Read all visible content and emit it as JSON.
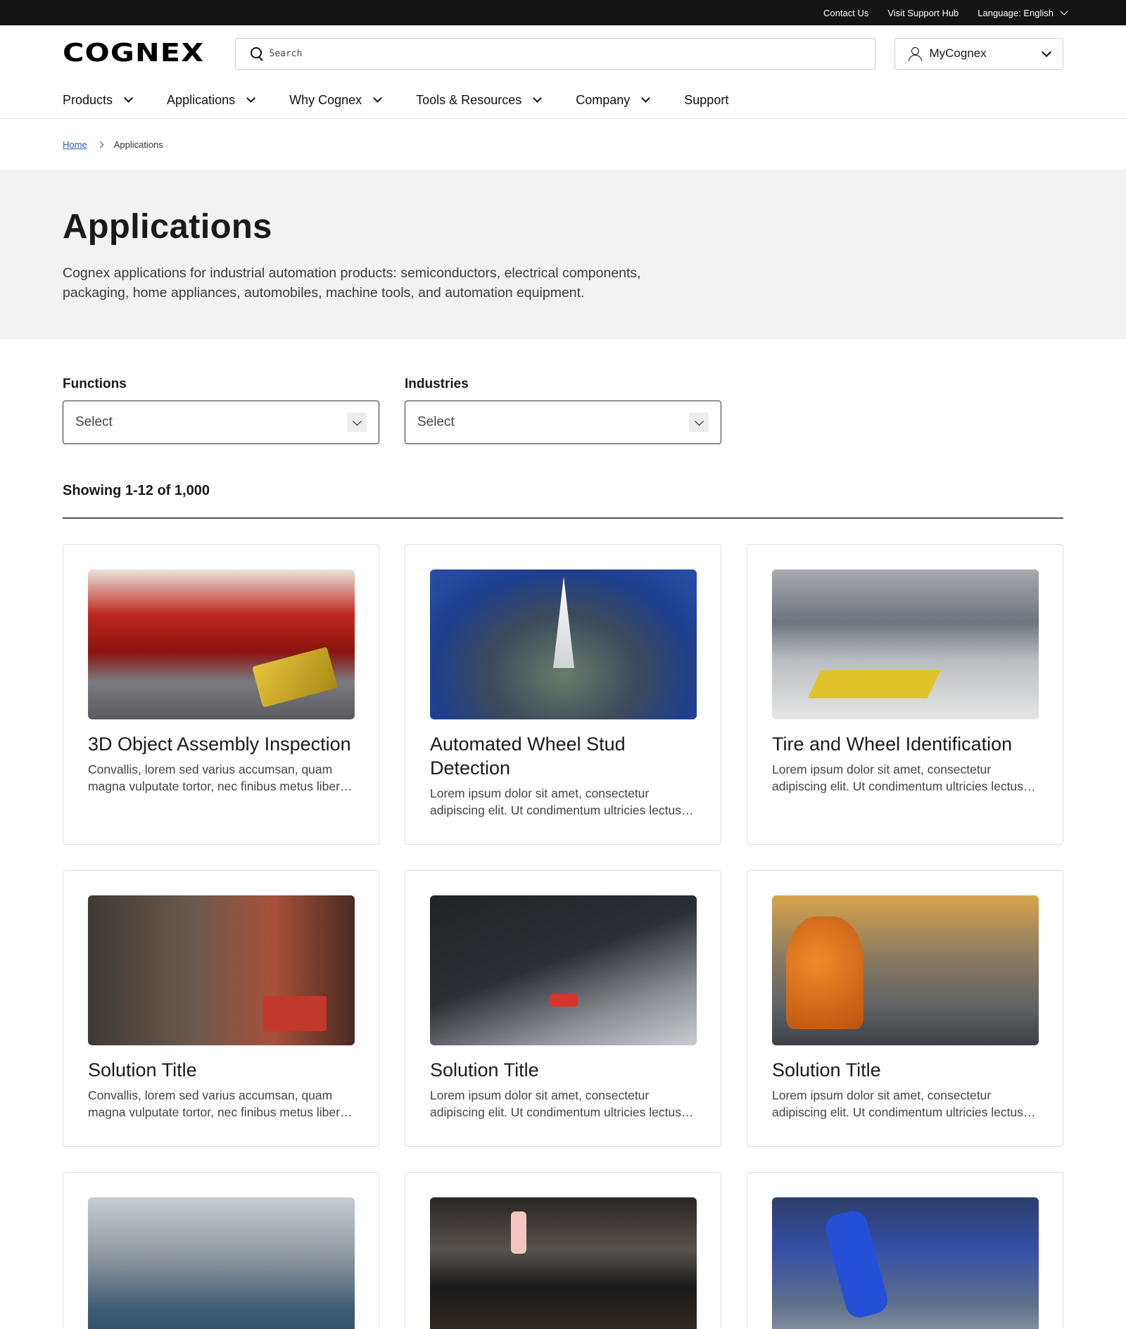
{
  "utility": {
    "contact": "Contact Us",
    "support_hub": "Visit Support Hub",
    "language": "Language: English"
  },
  "header": {
    "logo": "COGNEX",
    "search_placeholder": "Search",
    "account_label": "MyCognex"
  },
  "nav": {
    "items": [
      {
        "label": "Products",
        "has_dropdown": true
      },
      {
        "label": "Applications",
        "has_dropdown": true
      },
      {
        "label": "Why Cognex",
        "has_dropdown": true
      },
      {
        "label": "Tools & Resources",
        "has_dropdown": true
      },
      {
        "label": "Company",
        "has_dropdown": true
      },
      {
        "label": "Support",
        "has_dropdown": false
      }
    ]
  },
  "breadcrumb": {
    "home": "Home",
    "current": "Applications"
  },
  "hero": {
    "title": "Applications",
    "description": "Cognex applications for industrial automation products: semiconductors, electrical components, packaging, home appliances, automobiles, machine tools, and automation equipment."
  },
  "filters": {
    "functions": {
      "label": "Functions",
      "value": "Select"
    },
    "industries": {
      "label": "Industries",
      "value": "Select"
    }
  },
  "results": {
    "count_text": "Showing 1-12 of 1,000"
  },
  "cards": [
    {
      "title": "3D Object Assembly Inspection",
      "description": "Convallis, lorem sed varius accumsan, quam magna vulputate tortor, nec finibus metus libero at nunc."
    },
    {
      "title": "Automated Wheel Stud Detection",
      "description": "Lorem ipsum dolor sit amet, consectetur adipiscing elit. Ut condimentum ultricies lectus, vel tincidunt."
    },
    {
      "title": "Tire and Wheel Identification",
      "description": "Lorem ipsum dolor sit amet, consectetur adipiscing elit. Ut condimentum ultricies lectus, vel tincidunt."
    },
    {
      "title": "Solution Title",
      "description": "Convallis, lorem sed varius accumsan, quam magna vulputate tortor, nec finibus metus libero at nunc."
    },
    {
      "title": "Solution Title",
      "description": "Lorem ipsum dolor sit amet, consectetur adipiscing elit. Ut condimentum ultricies lectus, vel tincidunt."
    },
    {
      "title": "Solution Title",
      "description": "Lorem ipsum dolor sit amet, consectetur adipiscing elit. Ut condimentum ultricies lectus, vel tincidunt."
    }
  ],
  "colors": {
    "utility_bar": "#141414",
    "hero_bg": "#f2f2f2",
    "link": "#1f5fbf"
  }
}
